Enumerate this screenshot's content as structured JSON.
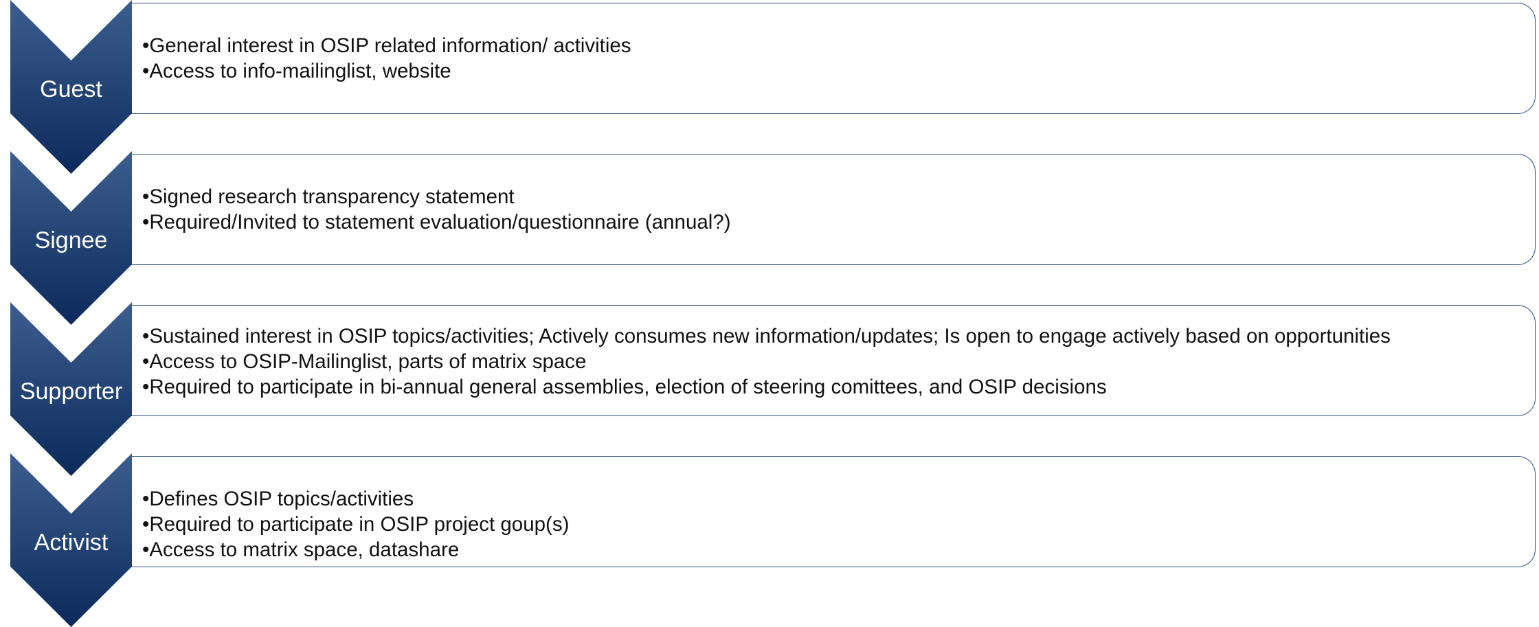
{
  "colors": {
    "chevron_top": "#3c5e8e",
    "chevron_bottom": "#0b2a5c",
    "box_border": "#2e4f7f",
    "label_text": "#ffffff",
    "body_text": "#111111"
  },
  "levels": [
    {
      "name": "Guest",
      "bullets": [
        "•General interest in OSIP related information/ activities",
        "•Access to info-mailinglist, website"
      ]
    },
    {
      "name": "Signee",
      "bullets": [
        "•Signed research transparency statement",
        "•Required/Invited to statement evaluation/questionnaire (annual?)"
      ]
    },
    {
      "name": "Supporter",
      "bullets": [
        "•Sustained interest in OSIP topics/activities; Actively consumes new information/updates; Is open to engage actively based on opportunities",
        "•Access to OSIP-Mailinglist, parts of matrix space",
        "•Required to participate in bi-annual general assemblies, election of steering comittees, and OSIP decisions"
      ]
    },
    {
      "name": "Activist",
      "bullets": [
        "•Defines OSIP topics/activities",
        "•Required to participate in OSIP project goup(s)",
        "•Access to matrix space, datashare"
      ]
    }
  ]
}
